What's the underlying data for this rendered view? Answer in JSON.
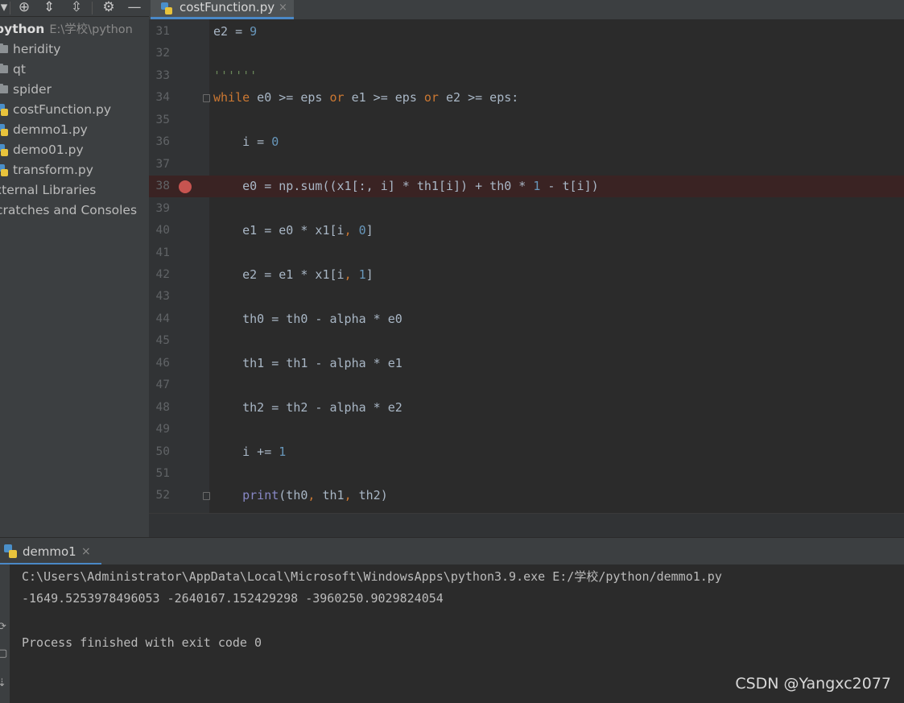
{
  "toolbar": {
    "icons": [
      "dropdown-arrow-icon",
      "locate-target-icon",
      "expand-all-icon",
      "collapse-all-icon",
      "gear-icon",
      "minimize-icon"
    ]
  },
  "project_tree": {
    "root": {
      "name": "python",
      "path": "E:\\学校\\python"
    },
    "items": [
      {
        "label": "heridity",
        "type": "folder"
      },
      {
        "label": "qt",
        "type": "folder"
      },
      {
        "label": "spider",
        "type": "folder"
      },
      {
        "label": "costFunction.py",
        "type": "python-file"
      },
      {
        "label": "demmo1.py",
        "type": "python-file"
      },
      {
        "label": "demo01.py",
        "type": "python-file"
      },
      {
        "label": "transform.py",
        "type": "python-file"
      }
    ],
    "external_libraries": "xternal Libraries",
    "scratches": "cratches and Consoles"
  },
  "editor": {
    "tab": {
      "label": "costFunction.py",
      "close": "×"
    },
    "lines": [
      {
        "n": "31",
        "html_tokens": [
          [
            "",
            "e2 = "
          ],
          [
            "num",
            "9"
          ]
        ]
      },
      {
        "n": "32",
        "html_tokens": []
      },
      {
        "n": "33",
        "html_tokens": [
          [
            "str",
            "''''''"
          ]
        ]
      },
      {
        "n": "34",
        "html_tokens": [
          [
            "kw",
            "while"
          ],
          [
            "",
            " e0 >= eps "
          ],
          [
            "kw",
            "or"
          ],
          [
            "",
            " e1 >= eps "
          ],
          [
            "kw",
            "or"
          ],
          [
            "",
            " e2 >= eps:"
          ]
        ]
      },
      {
        "n": "35",
        "html_tokens": []
      },
      {
        "n": "36",
        "html_tokens": [
          [
            "",
            "    i = "
          ],
          [
            "num",
            "0"
          ]
        ]
      },
      {
        "n": "37",
        "html_tokens": []
      },
      {
        "n": "38",
        "html_tokens": [
          [
            "",
            "    e0 = np.sum((x1[:, i] * th1[i]) + th0 * "
          ],
          [
            "num",
            "1"
          ],
          [
            "",
            " - t[i])"
          ]
        ]
      },
      {
        "n": "39",
        "html_tokens": []
      },
      {
        "n": "40",
        "html_tokens": [
          [
            "",
            "    e1 = e0 * x1[i"
          ],
          [
            "punc",
            ","
          ],
          [
            "",
            " "
          ],
          [
            "num",
            "0"
          ],
          [
            "",
            "]"
          ]
        ]
      },
      {
        "n": "41",
        "html_tokens": []
      },
      {
        "n": "42",
        "html_tokens": [
          [
            "",
            "    e2 = e1 * x1[i"
          ],
          [
            "punc",
            ","
          ],
          [
            "",
            " "
          ],
          [
            "num",
            "1"
          ],
          [
            "",
            "]"
          ]
        ]
      },
      {
        "n": "43",
        "html_tokens": []
      },
      {
        "n": "44",
        "html_tokens": [
          [
            "",
            "    th0 = th0 - alpha * e0"
          ]
        ]
      },
      {
        "n": "45",
        "html_tokens": []
      },
      {
        "n": "46",
        "html_tokens": [
          [
            "",
            "    th1 = th1 - alpha * e1"
          ]
        ]
      },
      {
        "n": "47",
        "html_tokens": []
      },
      {
        "n": "48",
        "html_tokens": [
          [
            "",
            "    th2 = th2 - alpha * e2"
          ]
        ]
      },
      {
        "n": "49",
        "html_tokens": []
      },
      {
        "n": "50",
        "html_tokens": [
          [
            "",
            "    i += "
          ],
          [
            "num",
            "1"
          ]
        ]
      },
      {
        "n": "51",
        "html_tokens": []
      },
      {
        "n": "52",
        "html_tokens": [
          [
            "",
            "    "
          ],
          [
            "bi",
            "print"
          ],
          [
            "",
            "(th0"
          ],
          [
            "punc",
            ","
          ],
          [
            "",
            " th1"
          ],
          [
            "punc",
            ","
          ],
          [
            "",
            " th2)"
          ]
        ]
      }
    ],
    "breakpoint_line": "38"
  },
  "run_panel": {
    "tab": {
      "label": "demmo1",
      "close": "×"
    },
    "output": [
      "C:\\Users\\Administrator\\AppData\\Local\\Microsoft\\WindowsApps\\python3.9.exe E:/学校/python/demmo1.py",
      "-1649.5253978496053 -2640167.152429298 -3960250.9029824054",
      "",
      "Process finished with exit code 0"
    ]
  },
  "watermark": "CSDN @Yangxc2077",
  "colors": {
    "keyword": "#cc7832",
    "number": "#6897bb",
    "string": "#6a8759",
    "builtin": "#8888c6",
    "breakpoint": "#c75450",
    "accent": "#4a88c7"
  }
}
